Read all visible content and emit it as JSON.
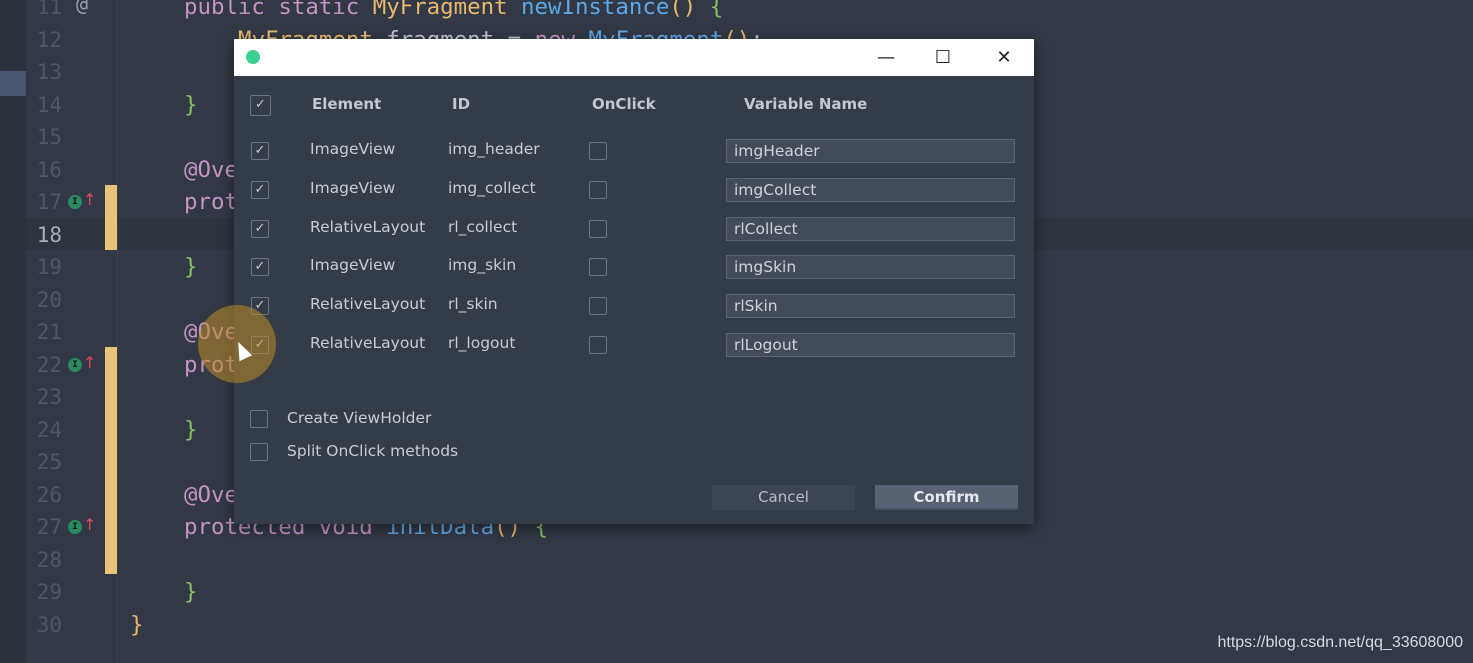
{
  "editor": {
    "lines": [
      {
        "n": "11",
        "tokens": [
          [
            "kw",
            "public static "
          ],
          [
            "ty",
            "MyFragment "
          ],
          [
            "fn",
            "newInstance"
          ],
          [
            "pr",
            "() "
          ],
          [
            "br",
            "{"
          ]
        ],
        "indent": 4
      },
      {
        "n": "12",
        "tokens": [
          [
            "ty",
            "MyFragment "
          ],
          [
            "",
            "fragment = "
          ],
          [
            "kw",
            "new "
          ],
          [
            "fn",
            "MyFragment"
          ],
          [
            "pr",
            "()"
          ],
          [
            "",
            "; "
          ]
        ],
        "indent": 8
      },
      {
        "n": "13",
        "tokens": [],
        "indent": 0
      },
      {
        "n": "14",
        "tokens": [
          [
            "br",
            "}"
          ]
        ],
        "indent": 4
      },
      {
        "n": "15",
        "tokens": [],
        "indent": 0
      },
      {
        "n": "16",
        "tokens": [
          [
            "kw",
            "@Ove"
          ]
        ],
        "indent": 4
      },
      {
        "n": "17",
        "tokens": [
          [
            "kw",
            "prot"
          ]
        ],
        "indent": 4
      },
      {
        "n": "18",
        "tokens": [],
        "indent": 0
      },
      {
        "n": "19",
        "tokens": [
          [
            "br",
            "}"
          ]
        ],
        "indent": 4
      },
      {
        "n": "20",
        "tokens": [],
        "indent": 0
      },
      {
        "n": "21",
        "tokens": [
          [
            "kw",
            "@Ove"
          ]
        ],
        "indent": 4
      },
      {
        "n": "22",
        "tokens": [
          [
            "kw",
            "prot"
          ]
        ],
        "indent": 4
      },
      {
        "n": "23",
        "tokens": [],
        "indent": 0
      },
      {
        "n": "24",
        "tokens": [
          [
            "br",
            "}"
          ]
        ],
        "indent": 4
      },
      {
        "n": "25",
        "tokens": [],
        "indent": 0
      },
      {
        "n": "26",
        "tokens": [
          [
            "kw",
            "@Ove"
          ]
        ],
        "indent": 4
      },
      {
        "n": "27",
        "tokens": [
          [
            "kw",
            "protected void "
          ],
          [
            "fn",
            "initData"
          ],
          [
            "pr",
            "() "
          ],
          [
            "br",
            "{"
          ]
        ],
        "indent": 4
      },
      {
        "n": "28",
        "tokens": [],
        "indent": 0
      },
      {
        "n": "29",
        "tokens": [
          [
            "br",
            "}"
          ]
        ],
        "indent": 4
      },
      {
        "n": "30",
        "tokens": [
          [
            "pr",
            "}"
          ]
        ],
        "indent": 0
      }
    ],
    "current_line": "18",
    "at_marker": "@",
    "override_marker": "I",
    "override_arrow": "↑"
  },
  "dialog": {
    "window_controls": {
      "minimize": "—",
      "maximize": "☐",
      "close": "✕"
    },
    "headers": {
      "element": "Element",
      "id": "ID",
      "onclick": "OnClick",
      "variable": "Variable Name"
    },
    "select_all_checked": true,
    "rows": [
      {
        "checked": true,
        "element": "ImageView",
        "id": "img_header",
        "onclick": false,
        "variable": "imgHeader"
      },
      {
        "checked": true,
        "element": "ImageView",
        "id": "img_collect",
        "onclick": false,
        "variable": "imgCollect"
      },
      {
        "checked": true,
        "element": "RelativeLayout",
        "id": "rl_collect",
        "onclick": false,
        "variable": "rlCollect"
      },
      {
        "checked": true,
        "element": "ImageView",
        "id": "img_skin",
        "onclick": false,
        "variable": "imgSkin"
      },
      {
        "checked": true,
        "element": "RelativeLayout",
        "id": "rl_skin",
        "onclick": false,
        "variable": "rlSkin"
      },
      {
        "checked": true,
        "element": "RelativeLayout",
        "id": "rl_logout",
        "onclick": false,
        "variable": "rlLogout"
      }
    ],
    "options": [
      {
        "label": "Create ViewHolder",
        "checked": false
      },
      {
        "label": "Split OnClick methods",
        "checked": false
      }
    ],
    "cancel_label": "Cancel",
    "confirm_label": "Confirm"
  },
  "watermark": "https://blog.csdn.net/qq_33608000",
  "colors": {
    "accent_marker": "#e8c17a",
    "app_icon": "#3ccf8e"
  }
}
